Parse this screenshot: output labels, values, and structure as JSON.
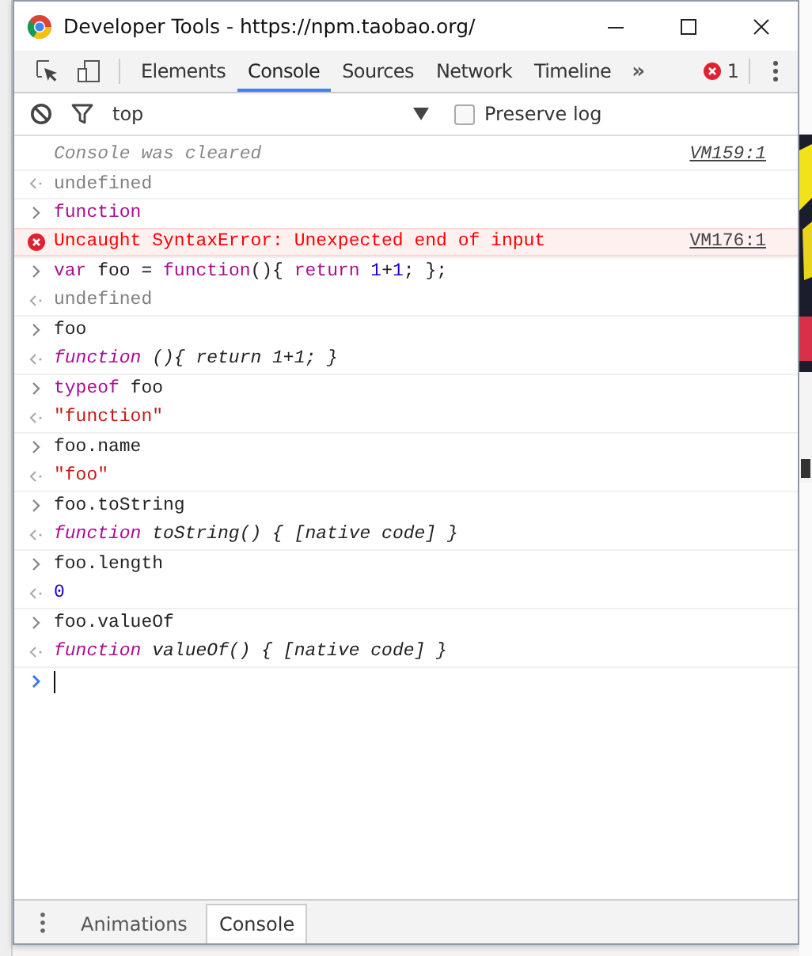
{
  "window": {
    "title": "Developer Tools - https://npm.taobao.org/"
  },
  "toolbar": {
    "tabs": [
      {
        "label": "Elements",
        "selected": false
      },
      {
        "label": "Console",
        "selected": true
      },
      {
        "label": "Sources",
        "selected": false
      },
      {
        "label": "Network",
        "selected": false
      },
      {
        "label": "Timeline",
        "selected": false
      }
    ],
    "more": "»",
    "error_count": "1"
  },
  "filter_bar": {
    "context": "top",
    "preserve_log": {
      "label": "Preserve log",
      "checked": false
    }
  },
  "console": {
    "lines": [
      {
        "kind": "info",
        "tokens": [
          {
            "kind": "plain",
            "text": "Console was cleared"
          }
        ],
        "source": "VM159:1"
      },
      {
        "kind": "output",
        "tokens": [
          {
            "kind": "undefined",
            "text": "undefined"
          }
        ]
      },
      {
        "kind": "input",
        "tokens": [
          {
            "kind": "keyword",
            "text": "function"
          }
        ]
      },
      {
        "kind": "error",
        "tokens": [
          {
            "kind": "plain",
            "text": "Uncaught SyntaxError: Unexpected end of input"
          }
        ],
        "source": "VM176:1"
      },
      {
        "kind": "input",
        "tokens": [
          {
            "kind": "keyword",
            "text": "var"
          },
          {
            "kind": "plain",
            "text": " foo = "
          },
          {
            "kind": "keyword",
            "text": "function"
          },
          {
            "kind": "plain",
            "text": "(){ "
          },
          {
            "kind": "keyword",
            "text": "return"
          },
          {
            "kind": "number",
            "text": " 1"
          },
          {
            "kind": "plain",
            "text": "+"
          },
          {
            "kind": "number",
            "text": "1"
          },
          {
            "kind": "plain",
            "text": "; };"
          }
        ]
      },
      {
        "kind": "output",
        "tokens": [
          {
            "kind": "undefined",
            "text": "undefined"
          }
        ]
      },
      {
        "kind": "input",
        "tokens": [
          {
            "kind": "plain",
            "text": "foo"
          }
        ]
      },
      {
        "kind": "output",
        "tokens": [
          {
            "kind": "fn-keyword",
            "text": "function"
          },
          {
            "kind": "fn-text",
            "text": " (){ return 1+1; }"
          }
        ]
      },
      {
        "kind": "input",
        "tokens": [
          {
            "kind": "keyword",
            "text": "typeof"
          },
          {
            "kind": "plain",
            "text": " foo"
          }
        ]
      },
      {
        "kind": "output",
        "tokens": [
          {
            "kind": "string",
            "text": "\"function\""
          }
        ]
      },
      {
        "kind": "input",
        "tokens": [
          {
            "kind": "plain",
            "text": "foo.name"
          }
        ]
      },
      {
        "kind": "output",
        "tokens": [
          {
            "kind": "string",
            "text": "\"foo\""
          }
        ]
      },
      {
        "kind": "input",
        "tokens": [
          {
            "kind": "plain",
            "text": "foo.toString"
          }
        ]
      },
      {
        "kind": "output",
        "tokens": [
          {
            "kind": "fn-keyword",
            "text": "function"
          },
          {
            "kind": "fn-text",
            "text": " toString() { [native code] }"
          }
        ]
      },
      {
        "kind": "input",
        "tokens": [
          {
            "kind": "plain",
            "text": "foo.length"
          }
        ]
      },
      {
        "kind": "output",
        "tokens": [
          {
            "kind": "number",
            "text": "0"
          }
        ]
      },
      {
        "kind": "input",
        "tokens": [
          {
            "kind": "plain",
            "text": "foo.valueOf"
          }
        ]
      },
      {
        "kind": "output",
        "tokens": [
          {
            "kind": "fn-keyword",
            "text": "function"
          },
          {
            "kind": "fn-text",
            "text": " valueOf() { [native code] }"
          }
        ]
      }
    ]
  },
  "drawer": {
    "tabs": [
      {
        "label": "Animations",
        "selected": false
      },
      {
        "label": "Console",
        "selected": true
      }
    ]
  }
}
